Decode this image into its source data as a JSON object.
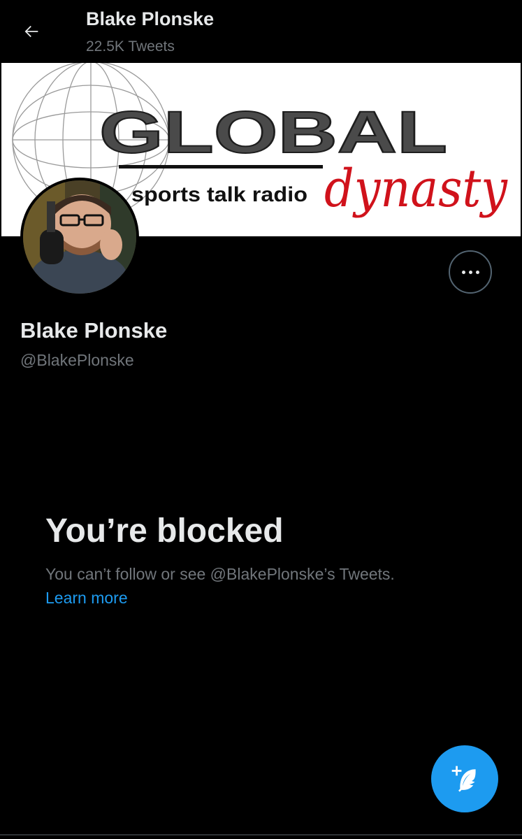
{
  "header": {
    "title": "Blake Plonske",
    "subtitle": "22.5K Tweets",
    "back_icon": "arrow-left-icon"
  },
  "banner": {
    "line1": "GLOBAL",
    "line2": "sports talk radio",
    "line3": "dynasty"
  },
  "profile": {
    "name": "Blake Plonske",
    "handle": "@BlakePlonske",
    "more_icon": "more-horizontal-icon"
  },
  "blocked": {
    "title": "You’re blocked",
    "message": "You can’t follow or see @BlakePlonske’s Tweets.",
    "link": "Learn more"
  },
  "fab": {
    "icon": "compose-tweet-icon"
  },
  "colors": {
    "background": "#000000",
    "primary_text": "#e7e9ea",
    "secondary_text": "#71767b",
    "accent": "#1d9bf0",
    "banner_red": "#d0121b",
    "banner_gray": "#4a4a4a"
  }
}
